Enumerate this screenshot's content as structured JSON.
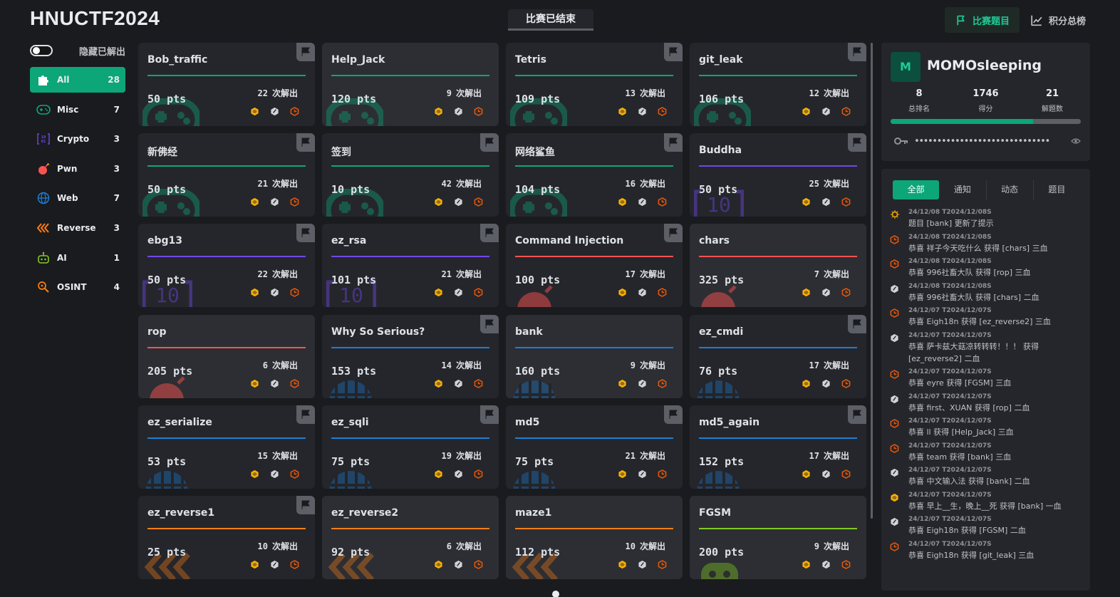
{
  "app": {
    "brand": "HNUCTF2024",
    "status": "比赛已结束"
  },
  "nav": {
    "challenges": "比赛题目",
    "scoreboard": "积分总榜"
  },
  "sidebar": {
    "hide_solved_label": "隐藏已解出",
    "categories": [
      {
        "name": "All",
        "count": "28",
        "icon": "puzzle-icon",
        "color": "#ffffff"
      },
      {
        "name": "Misc",
        "count": "7",
        "icon": "gamepad-icon",
        "color": "#0ca678"
      },
      {
        "name": "Crypto",
        "count": "3",
        "icon": "binary-icon",
        "color": "#7048e8"
      },
      {
        "name": "Pwn",
        "count": "3",
        "icon": "bomb-icon",
        "color": "#fa5252"
      },
      {
        "name": "Web",
        "count": "7",
        "icon": "globe-icon",
        "color": "#1c7ed6"
      },
      {
        "name": "Reverse",
        "count": "3",
        "icon": "chevrons-left-icon",
        "color": "#fd7e14"
      },
      {
        "name": "AI",
        "count": "1",
        "icon": "robot-icon",
        "color": "#82c91e"
      },
      {
        "name": "OSINT",
        "count": "4",
        "icon": "zoom-icon",
        "color": "#fd7e14"
      }
    ]
  },
  "solves_suffix": "次解出",
  "challenges": [
    {
      "title": "Bob_traffic",
      "points": "50 pts",
      "solves": "22",
      "category": "misc",
      "solved": false
    },
    {
      "title": "Help_Jack",
      "points": "120 pts",
      "solves": "9",
      "category": "misc",
      "solved": true
    },
    {
      "title": "Tetris",
      "points": "109 pts",
      "solves": "13",
      "category": "misc",
      "solved": false
    },
    {
      "title": "git_leak",
      "points": "106 pts",
      "solves": "12",
      "category": "misc",
      "solved": false
    },
    {
      "title": "新佛经",
      "points": "50 pts",
      "solves": "21",
      "category": "misc",
      "solved": false
    },
    {
      "title": "签到",
      "points": "10 pts",
      "solves": "42",
      "category": "misc",
      "solved": false
    },
    {
      "title": "网络鲨鱼",
      "points": "104 pts",
      "solves": "16",
      "category": "misc",
      "solved": false
    },
    {
      "title": "Buddha",
      "points": "50 pts",
      "solves": "25",
      "category": "crypto",
      "solved": false
    },
    {
      "title": "ebg13",
      "points": "50 pts",
      "solves": "22",
      "category": "crypto",
      "solved": false
    },
    {
      "title": "ez_rsa",
      "points": "101 pts",
      "solves": "21",
      "category": "crypto",
      "solved": false
    },
    {
      "title": "Command Injection",
      "points": "100 pts",
      "solves": "17",
      "category": "pwn",
      "solved": false
    },
    {
      "title": "chars",
      "points": "325 pts",
      "solves": "7",
      "category": "pwn",
      "solved": true
    },
    {
      "title": "rop",
      "points": "205 pts",
      "solves": "6",
      "category": "pwn",
      "solved": true
    },
    {
      "title": "Why So Serious?",
      "points": "153 pts",
      "solves": "14",
      "category": "web",
      "solved": false
    },
    {
      "title": "bank",
      "points": "160 pts",
      "solves": "9",
      "category": "web",
      "solved": true
    },
    {
      "title": "ez_cmdi",
      "points": "76 pts",
      "solves": "17",
      "category": "web",
      "solved": false
    },
    {
      "title": "ez_serialize",
      "points": "53 pts",
      "solves": "15",
      "category": "web",
      "solved": false
    },
    {
      "title": "ez_sqli",
      "points": "75 pts",
      "solves": "19",
      "category": "web",
      "solved": false
    },
    {
      "title": "md5",
      "points": "75 pts",
      "solves": "21",
      "category": "web",
      "solved": false
    },
    {
      "title": "md5_again",
      "points": "152 pts",
      "solves": "17",
      "category": "web",
      "solved": false
    },
    {
      "title": "ez_reverse1",
      "points": "25 pts",
      "solves": "10",
      "category": "reverse",
      "solved": false
    },
    {
      "title": "ez_reverse2",
      "points": "92 pts",
      "solves": "6",
      "category": "reverse",
      "solved": true
    },
    {
      "title": "maze1",
      "points": "112 pts",
      "solves": "10",
      "category": "reverse",
      "solved": true
    },
    {
      "title": "FGSM",
      "points": "200 pts",
      "solves": "9",
      "category": "ai",
      "solved": true
    }
  ],
  "category_colors": {
    "misc": "#0ca678",
    "crypto": "#7048e8",
    "pwn": "#fa5252",
    "web": "#1c7ed6",
    "reverse": "#fd7e14",
    "ai": "#82c91e"
  },
  "blood_colors": {
    "first": "#fab005",
    "second": "#ced4da",
    "third": "#e8590c"
  },
  "profile": {
    "avatar_letter": "M",
    "name": "MOMOsleeping",
    "rank": "8",
    "rank_label": "总排名",
    "score": "1746",
    "score_label": "得分",
    "solved": "21",
    "solved_label": "解题数",
    "progress_fraction": 0.75,
    "token_masked": "••••••••••••••••••••••••••••••"
  },
  "feed": {
    "tabs": [
      {
        "label": "全部",
        "active": true
      },
      {
        "label": "通知",
        "active": false
      },
      {
        "label": "动态",
        "active": false
      },
      {
        "label": "题目",
        "active": false
      }
    ],
    "events": [
      {
        "type": "hint",
        "time": "24/12/08 T2024/12/08S",
        "message": "题目 [bank] 更新了提示"
      },
      {
        "type": "third",
        "time": "24/12/08 T2024/12/08S",
        "message": "恭喜 祥子今天吃什么 获得 [chars] 三血"
      },
      {
        "type": "third",
        "time": "24/12/08 T2024/12/08S",
        "message": "恭喜 996社畜大队 获得 [rop] 三血"
      },
      {
        "type": "second",
        "time": "24/12/08 T2024/12/08S",
        "message": "恭喜 996社畜大队 获得 [chars] 二血"
      },
      {
        "type": "third",
        "time": "24/12/07 T2024/12/07S",
        "message": "恭喜 Eigh18n 获得 [ez_reverse2] 三血"
      },
      {
        "type": "second",
        "time": "24/12/07 T2024/12/07S",
        "message": "恭喜 萨卡兹大菇凉转转转！！！ 获得 [ez_reverse2] 二血"
      },
      {
        "type": "third",
        "time": "24/12/07 T2024/12/07S",
        "message": "恭喜 eyre 获得 [FGSM] 三血"
      },
      {
        "type": "second",
        "time": "24/12/07 T2024/12/07S",
        "message": "恭喜 first、XUAN 获得 [rop] 二血"
      },
      {
        "type": "third",
        "time": "24/12/07 T2024/12/07S",
        "message": "恭喜 ll 获得 [Help_Jack] 三血"
      },
      {
        "type": "third",
        "time": "24/12/07 T2024/12/07S",
        "message": "恭喜 team 获得 [bank] 三血"
      },
      {
        "type": "second",
        "time": "24/12/07 T2024/12/07S",
        "message": "恭喜 中文输入法 获得 [bank] 二血"
      },
      {
        "type": "first",
        "time": "24/12/07 T2024/12/07S",
        "message": "恭喜 早上__生，晚上__死 获得 [bank] 一血"
      },
      {
        "type": "second",
        "time": "24/12/07 T2024/12/07S",
        "message": "恭喜 Eigh18n 获得 [FGSM] 二血"
      },
      {
        "type": "third",
        "time": "24/12/07 T2024/12/07S",
        "message": "恭喜 Eigh18n 获得 [git_leak] 三血"
      }
    ]
  }
}
